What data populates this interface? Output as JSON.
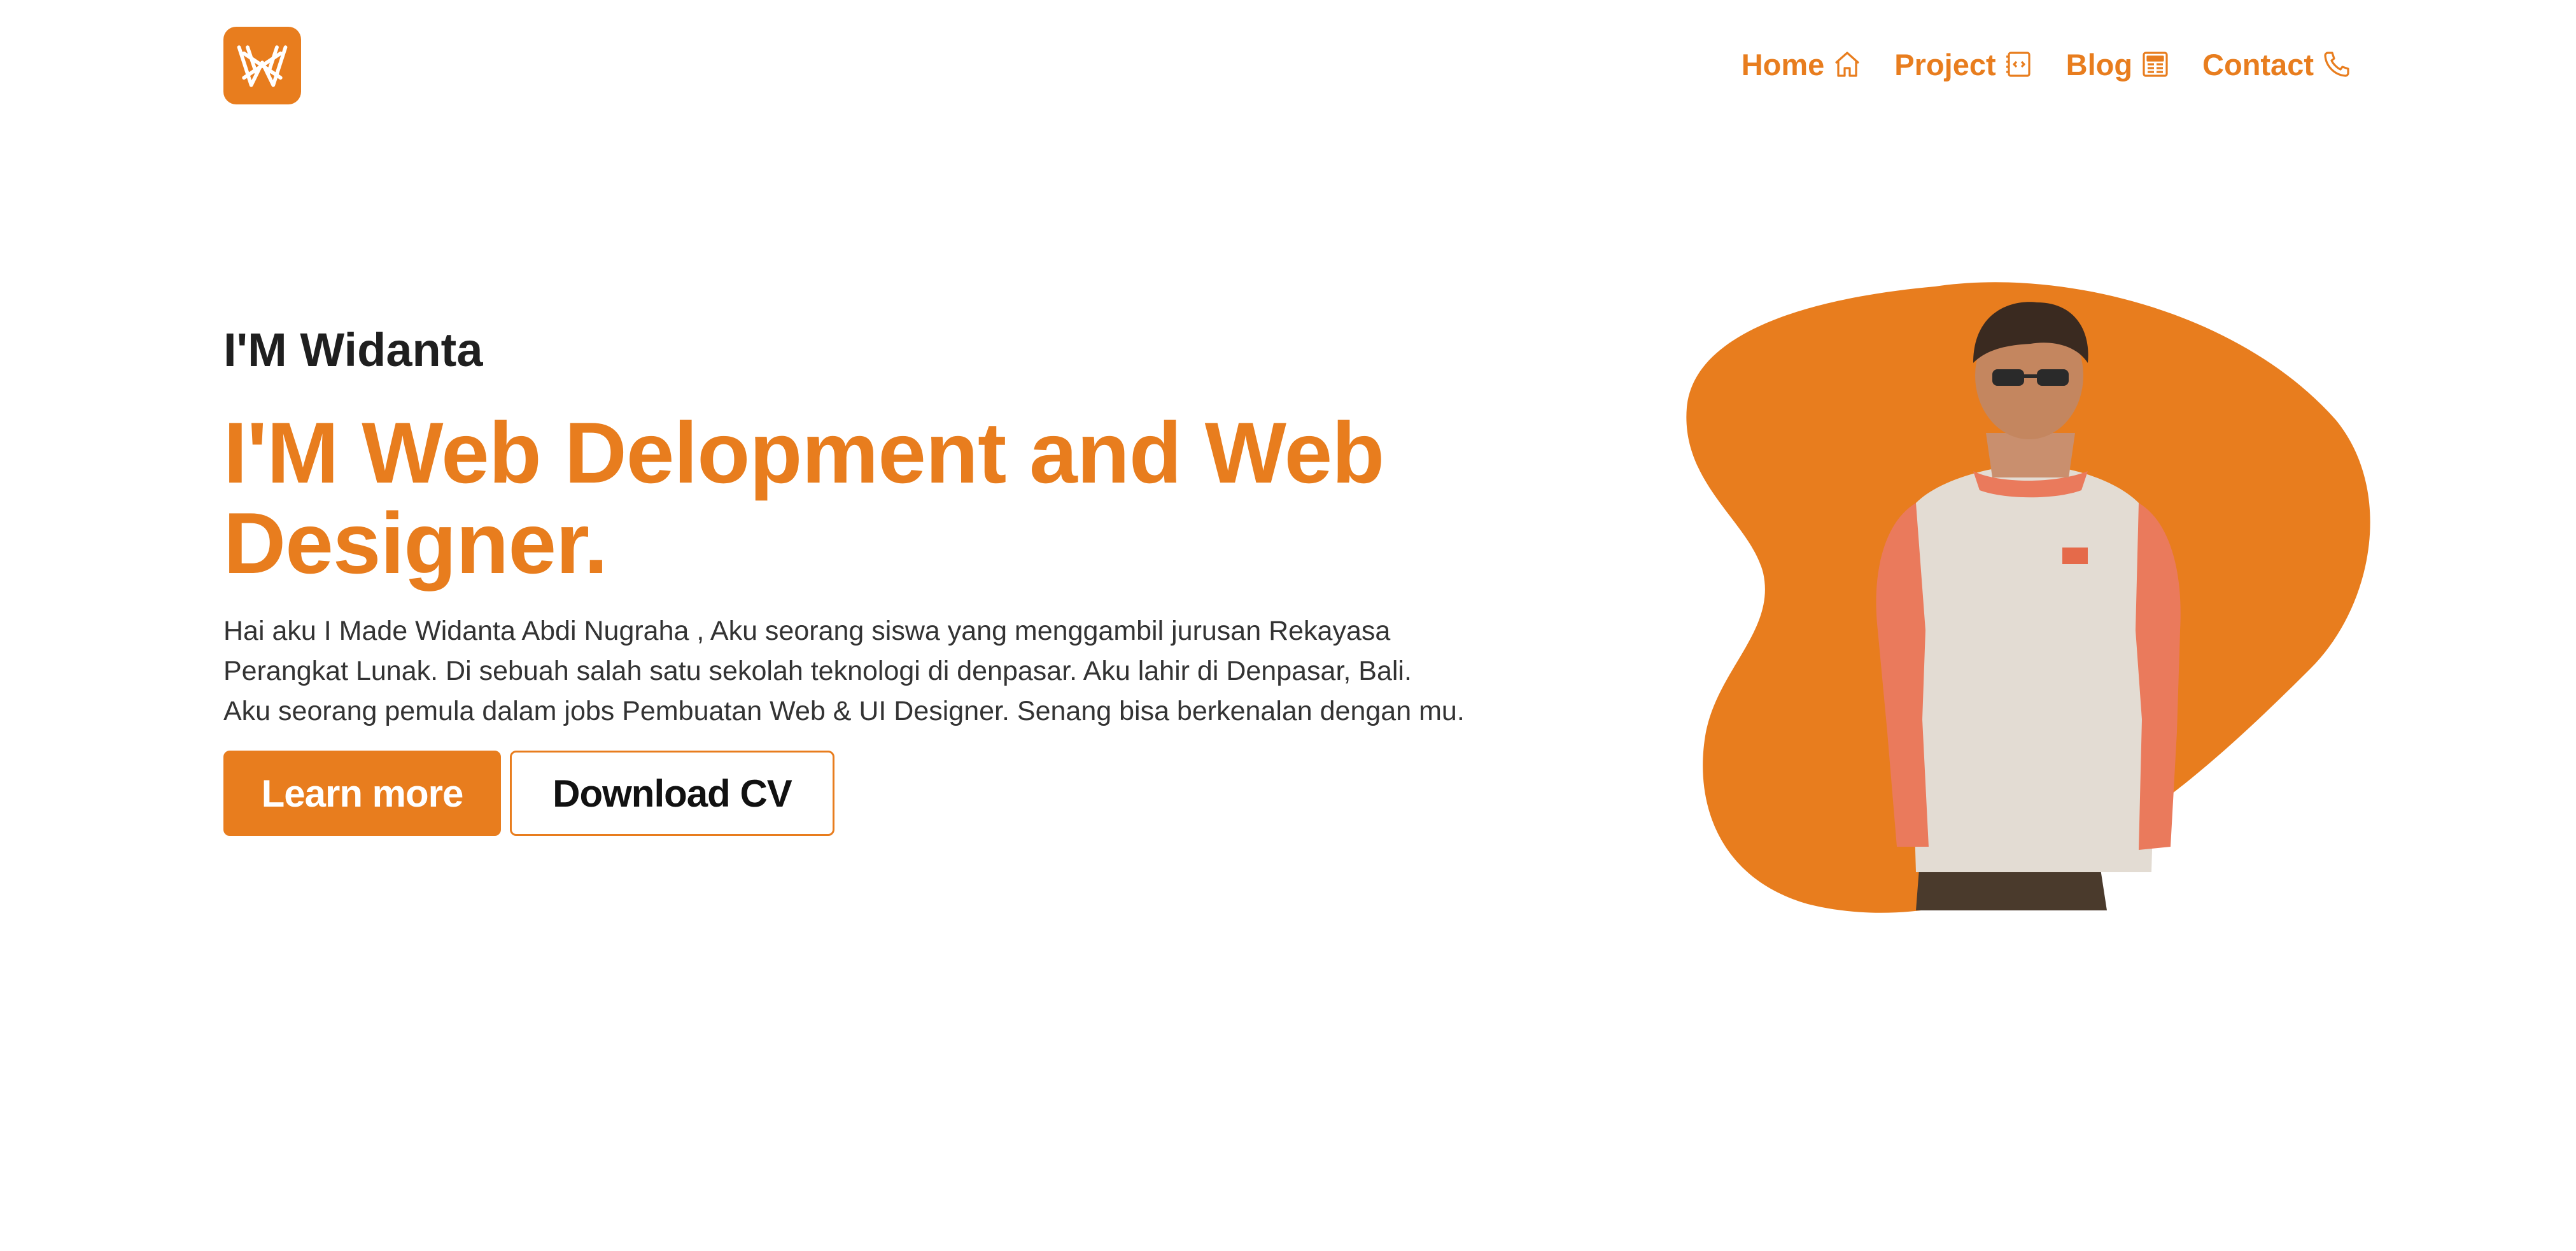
{
  "brand": {
    "logo_icon": "w-monogram-icon",
    "accent_color": "#e87d1e"
  },
  "nav": {
    "items": [
      {
        "label": "Home",
        "icon": "home-icon"
      },
      {
        "label": "Project",
        "icon": "code-file-icon"
      },
      {
        "label": "Blog",
        "icon": "newspaper-icon"
      },
      {
        "label": "Contact",
        "icon": "phone-icon"
      }
    ]
  },
  "hero": {
    "intro": "I'M Widanta",
    "headline": "I'M Web Delopment and Web Designer.",
    "bio": "Hai aku I Made Widanta Abdi Nugraha , Aku seorang siswa yang menggambil jurusan Rekayasa Perangkat Lunak. Di sebuah salah satu sekolah teknologi di denpasar. Aku lahir di Denpasar, Bali. Aku seorang pemula dalam jobs Pembuatan Web & UI Designer. Senang bisa berkenalan dengan mu.",
    "primary_button": "Learn more",
    "secondary_button": "Download CV",
    "photo_alt": "profile-photo"
  }
}
